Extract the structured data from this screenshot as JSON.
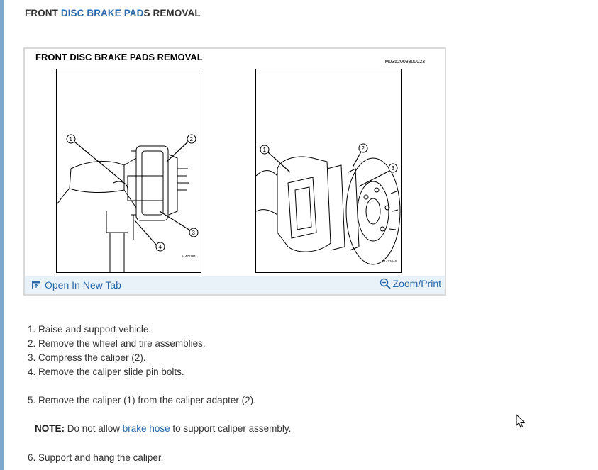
{
  "page": {
    "heading_pre": "FRONT ",
    "heading_link": "DISC BRAKE PAD",
    "heading_post": "S REMOVAL"
  },
  "figure": {
    "title": "FRONT DISC BRAKE PADS REMOVAL",
    "code": "M0352008800023",
    "left_panel": {
      "callouts": [
        "1",
        "2",
        "3",
        "4"
      ],
      "stamp": "51471184"
    },
    "right_panel": {
      "callouts": [
        "1",
        "2",
        "3"
      ],
      "stamp": "51471046"
    },
    "open_tab_label": "Open In New Tab",
    "zoom_label": "Zoom/Print"
  },
  "steps": {
    "s1": "1. Raise and support vehicle.",
    "s2": "2. Remove the wheel and tire assemblies.",
    "s3": "3. Compress the caliper (2).",
    "s4": "4. Remove the caliper slide pin bolts.",
    "s5": "5. Remove the caliper (1) from the caliper adapter (2).",
    "note_label": "NOTE:",
    "note_pre": " Do not allow ",
    "note_link": "brake hose",
    "note_post": " to support caliper assembly.",
    "s6": "6. Support and hang the caliper."
  },
  "colors": {
    "link": "#2a6aab",
    "bar": "#eaf2f9",
    "rule": "#7fa7c9"
  }
}
